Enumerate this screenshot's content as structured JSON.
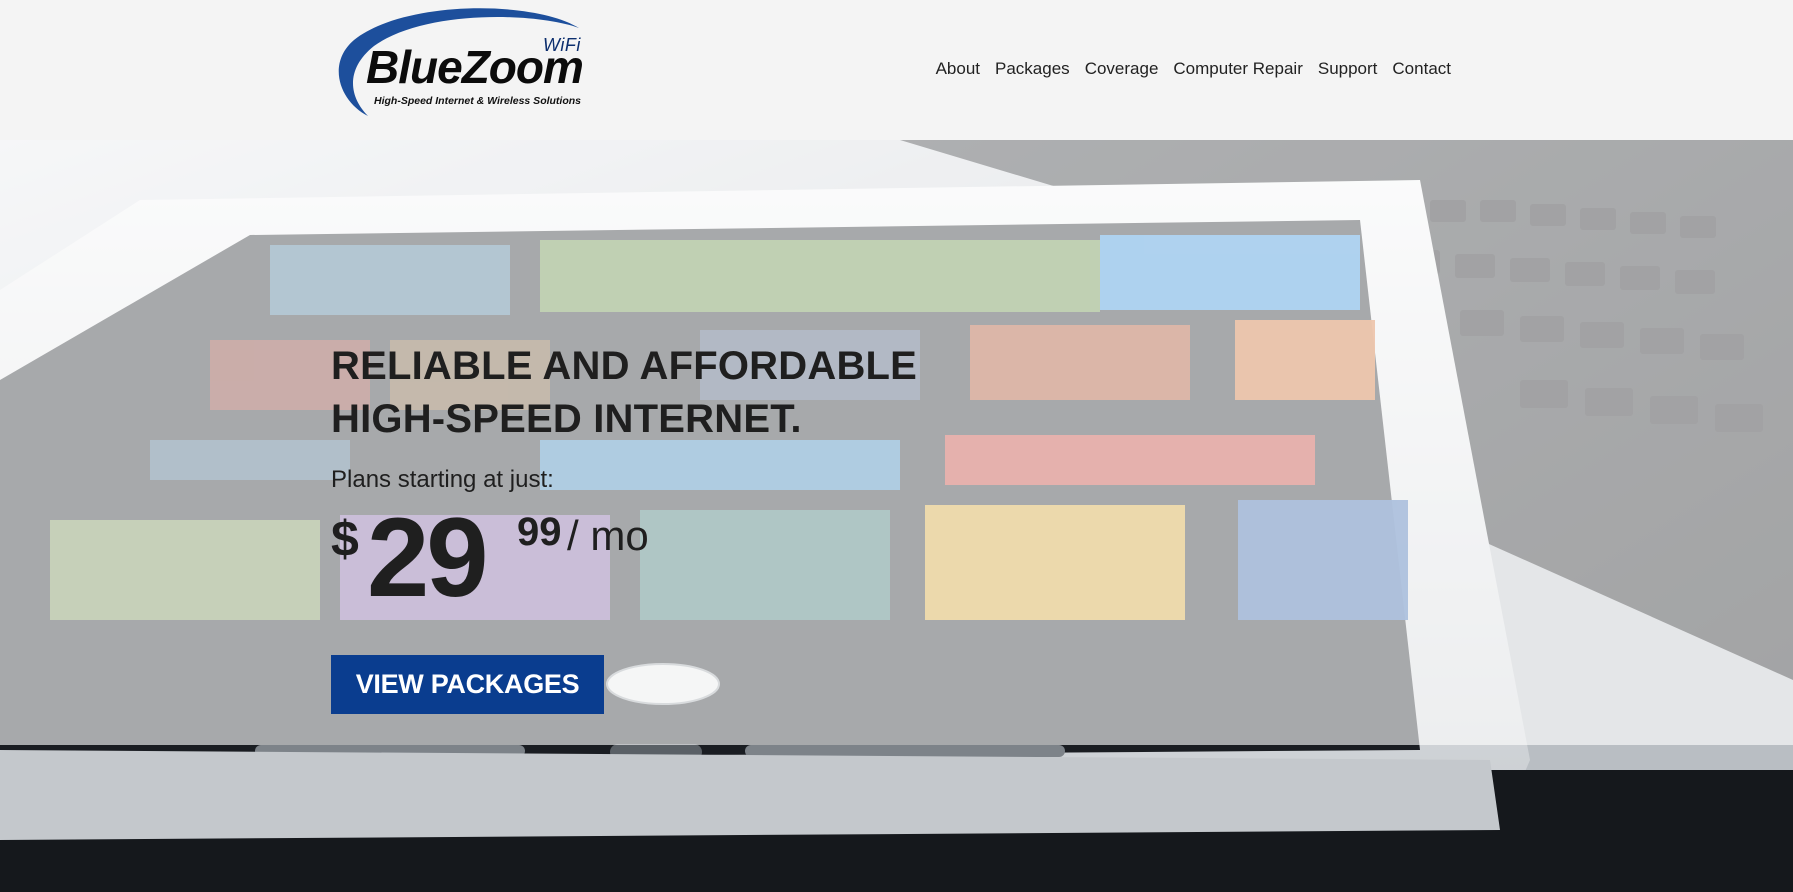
{
  "brand": {
    "name": "BlueZoom",
    "name_part1": "Blue",
    "name_part2": "Zoom",
    "wifi": "WiFi",
    "tagline": "High-Speed Internet & Wireless Solutions",
    "logo_icon": "swoosh-logo-icon",
    "colors": {
      "primary": "#0a3d8f",
      "swoosh": "#1d4f9c",
      "text": "#0b0b0b"
    }
  },
  "nav": {
    "items": [
      {
        "label": "About"
      },
      {
        "label": "Packages"
      },
      {
        "label": "Coverage"
      },
      {
        "label": "Computer Repair"
      },
      {
        "label": "Support"
      },
      {
        "label": "Contact"
      }
    ]
  },
  "hero": {
    "headline_line1": "RELIABLE AND AFFORDABLE",
    "headline_line2": "HIGH-SPEED INTERNET.",
    "subline": "Plans starting at just:",
    "price": {
      "currency": "$",
      "dollars": "29",
      "cents": "99",
      "per": "/ mo"
    },
    "cta_label": "VIEW PACKAGES",
    "background_icon": "tablet-on-laptop-photo"
  }
}
